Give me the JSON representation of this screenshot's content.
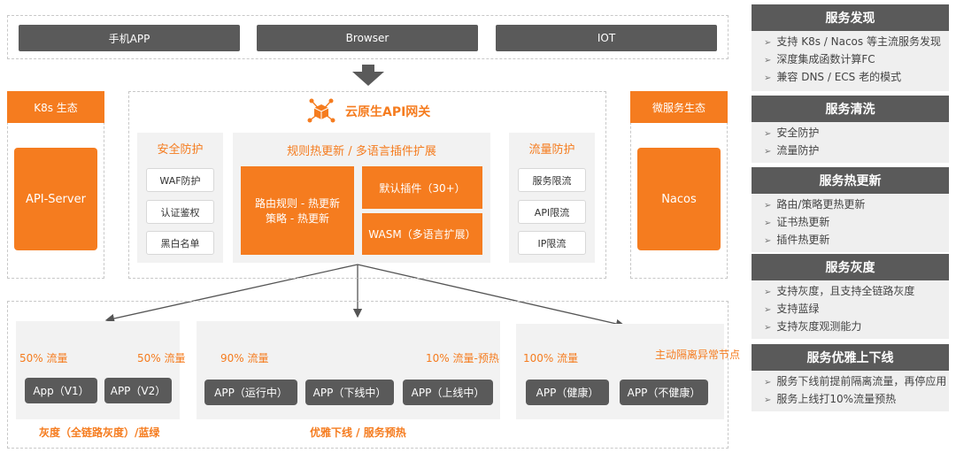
{
  "clients": [
    "手机APP",
    "Browser",
    "IOT"
  ],
  "k8s": {
    "header": "K8s 生态",
    "box": "API-Server"
  },
  "micro": {
    "header": "微服务生态",
    "box": "Nacos"
  },
  "gateway": {
    "title": "云原生API网关",
    "security": {
      "title": "安全防护",
      "items": [
        "WAF防护",
        "认证鉴权",
        "黑白名单"
      ]
    },
    "rules": {
      "title": "规则热更新 / 多语言插件扩展",
      "left": [
        "路由规则 - 热更新",
        "策略 - 热更新"
      ],
      "plugins": "默认插件（30+）",
      "wasm": "WASM（多语言扩展）"
    },
    "traffic": {
      "title": "流量防护",
      "items": [
        "服务限流",
        "API限流",
        "IP限流"
      ]
    }
  },
  "groups": {
    "gray": {
      "left_pct": "50% 流量",
      "right_pct": "50% 流量",
      "apps": [
        "App（V1）",
        "APP（V2）"
      ],
      "footer": "灰度（全链路灰度）/蓝绿"
    },
    "graceful": {
      "left_pct": "90% 流量",
      "right_pct": "10% 流量-预热",
      "apps": [
        "APP（运行中）",
        "APP（下线中）",
        "APP（上线中）"
      ],
      "footer": "优雅下线 / 服务预热"
    },
    "health": {
      "left_pct": "100% 流量",
      "right_note": "主动隔离异常节点",
      "apps": [
        "APP（健康）",
        "APP（不健康）"
      ]
    }
  },
  "right_panel": [
    {
      "title": "服务发现",
      "items": [
        "支持 K8s / Nacos 等主流服务发现",
        "深度集成函数计算FC",
        "兼容 DNS / ECS 老的模式"
      ]
    },
    {
      "title": "服务清洗",
      "items": [
        "安全防护",
        "流量防护"
      ]
    },
    {
      "title": "服务热更新",
      "items": [
        "路由/策略更热更新",
        "证书热更新",
        "插件热更新"
      ]
    },
    {
      "title": "服务灰度",
      "items": [
        "支持灰度，且支持全链路灰度",
        "支持蓝绿",
        "支持灰度观测能力"
      ]
    },
    {
      "title": "服务优雅上下线",
      "items": [
        "服务下线前提前隔离流量，再停应用",
        "服务上线打10%流量预热"
      ]
    }
  ],
  "colors": {
    "accent": "#f57c1f",
    "dark": "#5a5a5a",
    "panel": "#efefef"
  },
  "icons": {
    "gateway": "cube-network-icon",
    "arrow": "down-arrow-icon",
    "bullet": "chevron-right-icon"
  }
}
